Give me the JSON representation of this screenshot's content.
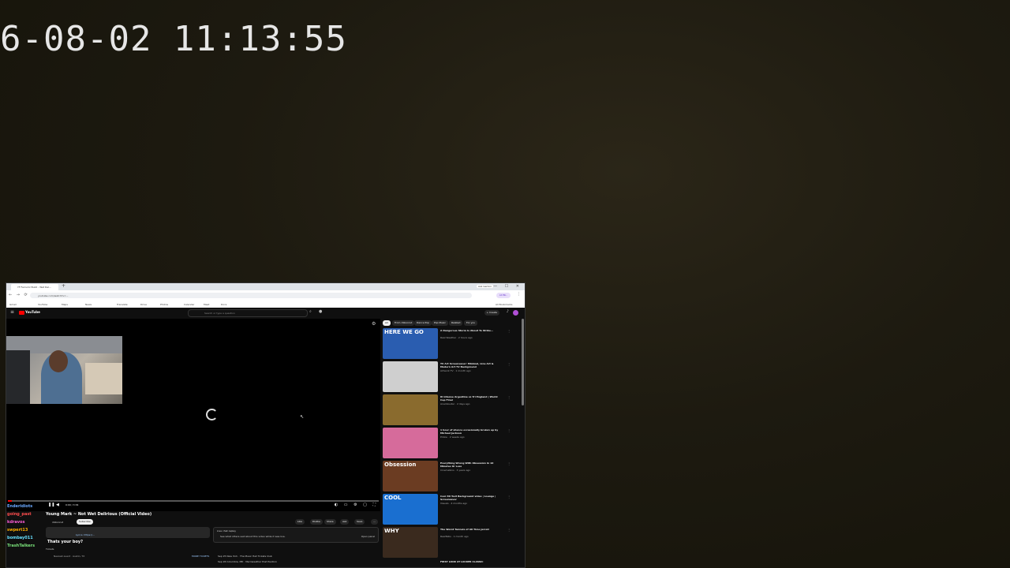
{
  "clock": "6-08-02 11:13:55",
  "browser": {
    "tab_title": "YF Ferrumz Build - Wet Del...",
    "new_tab": "+",
    "ask_gemini": "Ask Gemini",
    "window_controls": "— ☐ ✕",
    "url": "youtube.com/watch?v=...",
    "profile": "All Bk..",
    "bookmarks": [
      "Gmail",
      "YouTube",
      "Maps",
      "News",
      "Translate",
      "Drive",
      "Photos",
      "Calendar",
      "Meet",
      "Docs",
      "All Bookmarks"
    ]
  },
  "youtube": {
    "logo_text": "YouTube",
    "search_placeholder": "Search or type a question",
    "create_label": "+ Create",
    "video_title": "Young Mark ~ Not Wet Delirious (Official Video)",
    "channel": "ribbonrut",
    "subscribe": "Subscribe",
    "actions": [
      "Like",
      "Dislike",
      "Share",
      "Ask",
      "Save",
      "..."
    ],
    "time": "0:00 / 3:34",
    "progress_fraction": 0.01,
    "description": "Lyrics: https://...",
    "live_chat_title": "Live chat replay",
    "live_chat_sub": "See what others said about this video while it was live.",
    "open_panel": "Open panel",
    "ticket_row": "Tickets",
    "nearest_event": "Nearest event · Austin, TX",
    "more_tickets": "MORE TICKETS",
    "event1": "Sep 25  New York · The Music Hall Tickets Club",
    "event2": "Sep 26  Columbia, MD · Merriweather Post Pavilion",
    "chips": [
      "All",
      "From ribbonrut",
      "Dance Pop",
      "Pop Music",
      "Related",
      "For you"
    ],
    "recommendations": [
      {
        "title": "A Dangerous Storm Is About To Strike...",
        "meta": "Real Weather · 2 hours ago",
        "thumb_text": "HERE\nWE GO",
        "bg": "#2a5db0"
      },
      {
        "title": "TV Art Screensaver: Minimal, Line Art & Modern Art TV Background",
        "meta": "Artwork TV · 1 month ago",
        "thumb_text": "",
        "bg": "#cfcfcf"
      },
      {
        "title": "Ill Intense Argentina vs Tri England | World Cup Final",
        "meta": "Anadolustar · 2 days ago",
        "thumb_text": "",
        "bg": "#8a6b2e"
      },
      {
        "title": "1 hour of silence occasionally broken up by Michael Jackson",
        "meta": "Pinkie · 2 weeks ago",
        "thumb_text": "",
        "bg": "#d66b9b"
      },
      {
        "title": "Everything Wrong With Obsession In 10 Minutes Or Less",
        "meta": "CinemaSins · 3 years ago",
        "thumb_text": "Obsession",
        "bg": "#6b3c22"
      },
      {
        "title": "Cool 3D Text Background video | Lounge | Screensaver",
        "meta": "Visuals · 4 months ago",
        "thumb_text": "COOL",
        "bg": "#1a6fd0"
      },
      {
        "title": "The Worst Tunnels of All Time Jerrell",
        "meta": "RealTalks · 1 month ago",
        "thumb_text": "WHY",
        "bg": "#3a2a1e"
      }
    ],
    "last_item": "FIRST LOOK AT LOCKER CLASSIC"
  },
  "chat": [
    {
      "name": "Enderidiots",
      "color": "#6aa8ff"
    },
    {
      "name": "going_past",
      "color": "#ff4d4d"
    },
    {
      "name": "kdravos",
      "color": "#ff5ed8"
    },
    {
      "name": "swpert13",
      "color": "#ffb000"
    },
    {
      "name": "bombay011",
      "color": "#66e0ff"
    },
    {
      "name": "TrashTalkers",
      "color": "#79e079"
    }
  ],
  "ban_message": "Thats your boy?",
  "chat_label_young_mark": "YOUNG MARK"
}
